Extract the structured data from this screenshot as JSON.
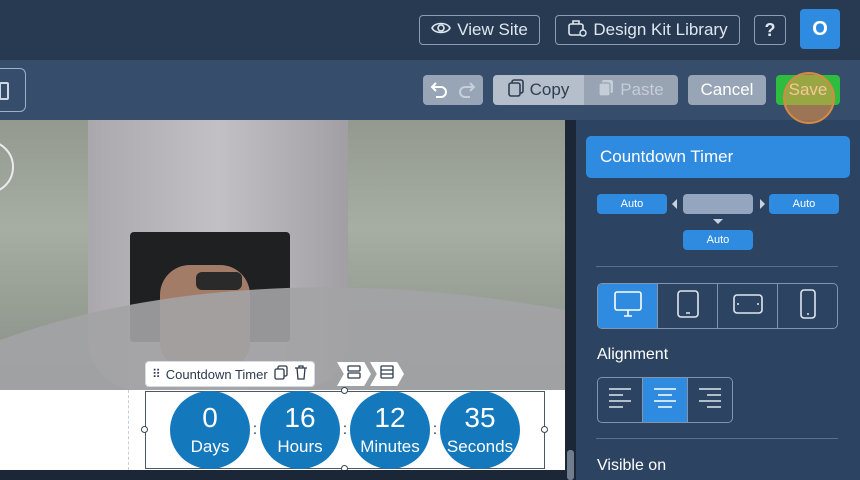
{
  "topbar": {
    "view_site_label": "View Site",
    "design_kit_label": "Design Kit Library",
    "help_label": "?",
    "avatar_initial": "O"
  },
  "toolbar": {
    "copy_label": "Copy",
    "paste_label": "Paste",
    "cancel_label": "Cancel",
    "save_label": "Save"
  },
  "canvas": {
    "widget_label": "Countdown Timer",
    "timer": [
      {
        "value": "0",
        "label": "Days"
      },
      {
        "value": "16",
        "label": "Hours"
      },
      {
        "value": "12",
        "label": "Minutes"
      },
      {
        "value": "35",
        "label": "Seconds"
      }
    ],
    "separator": ":"
  },
  "panel": {
    "title": "Countdown Timer",
    "spacing": {
      "left": "Auto",
      "right": "Auto",
      "bottom": "Auto"
    },
    "devices": [
      "desktop",
      "tablet",
      "tablet-landscape",
      "mobile"
    ],
    "active_device": "desktop",
    "alignment_label": "Alignment",
    "alignment_options": [
      "left",
      "center",
      "right"
    ],
    "active_alignment": "center",
    "visible_on_label": "Visible on"
  },
  "colors": {
    "accent": "#2f8be0",
    "save": "#2fbd3f",
    "timer": "#1478bd",
    "panel": "#2c4462"
  }
}
